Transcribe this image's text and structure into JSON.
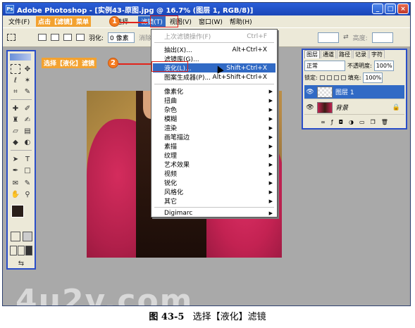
{
  "window": {
    "title": "Adobe Photoshop - [实例43-原图.jpg @ 16.7% (图层 1, RGB/8)]",
    "minimize": "_",
    "maximize": "□",
    "close": "×"
  },
  "menubar": {
    "items": [
      "文件(F)",
      "点击【滤镜】菜单",
      "选择",
      "滤镜(T)",
      "视图(V)",
      "窗口(W)",
      "帮助(H)"
    ]
  },
  "options_bar": {
    "feather_label": "羽化:",
    "feather_value": "0 像素",
    "antialias_label": "消除锯",
    "height_label": "高度:"
  },
  "callouts": {
    "step1": "1",
    "step2": "2",
    "step1_text": "点击【滤镜】菜单",
    "step2_text": "选择【液化】滤镜"
  },
  "filter_menu": {
    "items": [
      {
        "label": "上次滤镜操作(F)",
        "shortcut": "Ctrl+F",
        "disabled": true
      },
      {
        "label": "抽出(X)...",
        "shortcut": "Alt+Ctrl+X"
      },
      {
        "label": "滤镜库(G)..."
      },
      {
        "label": "液化(L)...",
        "shortcut": "Shift+Ctrl+X",
        "highlight": true
      },
      {
        "label": "图案生成器(P)...",
        "shortcut": "Alt+Shift+Ctrl+X"
      },
      {
        "label": "像素化",
        "submenu": true
      },
      {
        "label": "扭曲",
        "submenu": true
      },
      {
        "label": "杂色",
        "submenu": true
      },
      {
        "label": "模糊",
        "submenu": true
      },
      {
        "label": "渲染",
        "submenu": true
      },
      {
        "label": "画笔描边",
        "submenu": true
      },
      {
        "label": "素描",
        "submenu": true
      },
      {
        "label": "纹理",
        "submenu": true
      },
      {
        "label": "艺术效果",
        "submenu": true
      },
      {
        "label": "视频",
        "submenu": true
      },
      {
        "label": "锐化",
        "submenu": true
      },
      {
        "label": "风格化",
        "submenu": true
      },
      {
        "label": "其它",
        "submenu": true
      },
      {
        "label": "Digimarc",
        "submenu": true
      }
    ]
  },
  "layers_panel": {
    "tabs": [
      "图层",
      "通道",
      "路径",
      "记录",
      "字符"
    ],
    "blend_mode": "正常",
    "opacity_label": "不透明度:",
    "opacity_value": "100%",
    "lock_label": "锁定:",
    "fill_label": "填充:",
    "fill_value": "100%",
    "layers": [
      {
        "name": "图层 1",
        "selected": true
      },
      {
        "name": "背景",
        "selected": false
      }
    ]
  },
  "caption": {
    "figure": "图 43-5",
    "text": "选择【液化】滤镜"
  },
  "watermark": "4u2v.com"
}
